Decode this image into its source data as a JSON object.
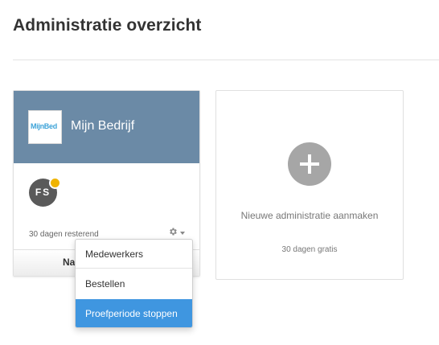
{
  "page": {
    "title": "Administratie overzicht"
  },
  "company_card": {
    "logo_text": "MijnBed",
    "name": "Mijn Bedrijf",
    "avatar_initials": "FS",
    "days_remaining": "30 dagen resterend",
    "footer_label": "Na",
    "header_color": "#6b8aa6",
    "badge_color": "#f0b400",
    "settings_icon": "gear-icon"
  },
  "new_card": {
    "label": "Nieuwe administratie aanmaken",
    "sub_label": "30 dagen gratis",
    "icon": "plus-icon"
  },
  "dropdown": {
    "items": [
      {
        "label": "Medewerkers"
      },
      {
        "label": "Bestellen"
      },
      {
        "label": "Proefperiode stoppen"
      }
    ],
    "active_color": "#3f96e0"
  }
}
